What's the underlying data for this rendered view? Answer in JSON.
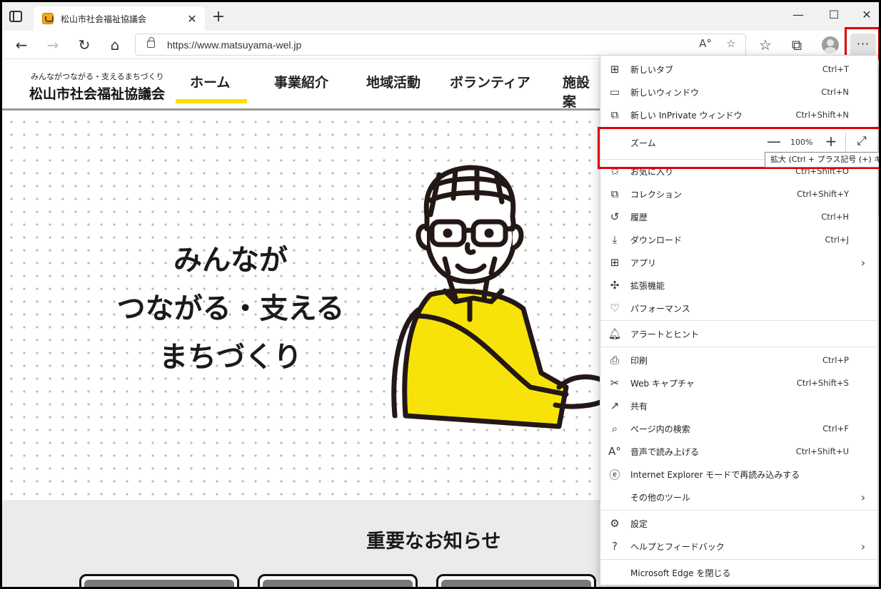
{
  "browser": {
    "tab_title": "松山市社会福祉協議会",
    "tab_close": "✕",
    "new_tab": "+",
    "url": "https://www.matsuyama-wel.jp",
    "more_button": "···"
  },
  "site": {
    "tagline": "みんながつながる・支えるまちづくり",
    "org_name": "松山市社会福祉協議会",
    "nav": [
      "ホーム",
      "事業紹介",
      "地域活動",
      "ボランティア",
      "施設案"
    ],
    "hero_lines": [
      "みんなが",
      "つながる・支える",
      "まちづくり"
    ],
    "notice_title": "重要なお知らせ"
  },
  "menu": {
    "items_top": [
      {
        "icon": "new-tab-icon",
        "label": "新しいタブ",
        "shortcut": "Ctrl+T"
      },
      {
        "icon": "new-window-icon",
        "label": "新しいウィンドウ",
        "shortcut": "Ctrl+N"
      },
      {
        "icon": "inprivate-icon",
        "label": "新しい InPrivate ウィンドウ",
        "shortcut": "Ctrl+Shift+N"
      }
    ],
    "zoom": {
      "label": "ズーム",
      "minus": "—",
      "value": "100%",
      "plus": "+"
    },
    "tooltip": "拡大 (Ctrl + プラス記号 (+) キー)",
    "items_mid": [
      {
        "icon": "favorites-icon",
        "label": "お気に入り",
        "shortcut": "Ctrl+Shift+O"
      },
      {
        "icon": "collections-icon",
        "label": "コレクション",
        "shortcut": "Ctrl+Shift+Y"
      },
      {
        "icon": "history-icon",
        "label": "履歴",
        "shortcut": "Ctrl+H"
      },
      {
        "icon": "download-icon",
        "label": "ダウンロード",
        "shortcut": "Ctrl+J"
      },
      {
        "icon": "apps-icon",
        "label": "アプリ",
        "shortcut": "",
        "arrow": true
      },
      {
        "icon": "extensions-icon",
        "label": "拡張機能",
        "shortcut": ""
      },
      {
        "icon": "performance-icon",
        "label": "パフォーマンス",
        "shortcut": ""
      }
    ],
    "alerts": {
      "icon": "bell-icon",
      "label": "アラートとヒント"
    },
    "items_tools": [
      {
        "icon": "print-icon",
        "label": "印刷",
        "shortcut": "Ctrl+P"
      },
      {
        "icon": "web-capture-icon",
        "label": "Web キャプチャ",
        "shortcut": "Ctrl+Shift+S"
      },
      {
        "icon": "share-icon",
        "label": "共有",
        "shortcut": ""
      },
      {
        "icon": "find-icon",
        "label": "ページ内の検索",
        "shortcut": "Ctrl+F"
      },
      {
        "icon": "read-aloud-icon",
        "label": "音声で読み上げる",
        "shortcut": "Ctrl+Shift+U"
      },
      {
        "icon": "ie-mode-icon",
        "label": "Internet Explorer モードで再読み込みする",
        "shortcut": ""
      },
      {
        "icon": "",
        "label": "その他のツール",
        "shortcut": "",
        "arrow": true
      }
    ],
    "settings": {
      "icon": "gear-icon",
      "label": "設定"
    },
    "help": {
      "icon": "help-icon",
      "label": "ヘルプとフィードバック"
    },
    "close_edge": "Microsoft Edge を閉じる"
  },
  "colors": {
    "accent_yellow": "#ffdf00",
    "highlight_red": "#e00000"
  }
}
